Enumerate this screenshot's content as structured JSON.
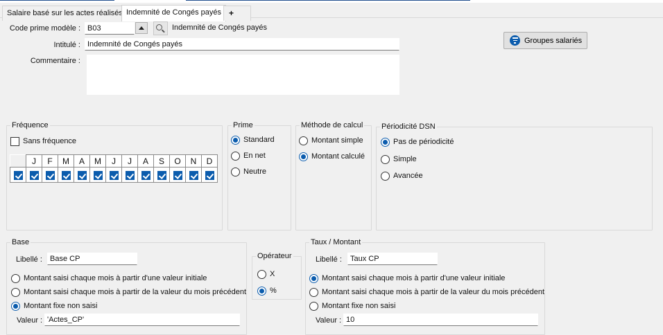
{
  "tabs": [
    {
      "label": "Salaire basé sur les actes réalisés"
    },
    {
      "label": "Indemnité de Congés payés"
    },
    {
      "label": "+"
    }
  ],
  "header": {
    "code_label": "Code prime modèle :",
    "code_value": "B03",
    "code_description": "Indemnité de Congés payés",
    "intitule_label": "Intitulé :",
    "intitule_value": "Indemnité de Congés payés",
    "commentaire_label": "Commentaire :",
    "commentaire_value": "",
    "groupes_button": "Groupes salariés"
  },
  "frequence": {
    "legend": "Fréquence",
    "sans_frequence_label": "Sans fréquence",
    "sans_frequence_checked": false,
    "months": [
      "J",
      "F",
      "M",
      "A",
      "M",
      "J",
      "J",
      "A",
      "S",
      "O",
      "N",
      "D"
    ],
    "months_checked": [
      true,
      true,
      true,
      true,
      true,
      true,
      true,
      true,
      true,
      true,
      true,
      true
    ]
  },
  "prime": {
    "legend": "Prime",
    "options": [
      "Standard",
      "En net",
      "Neutre"
    ],
    "selected": "Standard"
  },
  "methode": {
    "legend": "Méthode de calcul",
    "options": [
      "Montant simple",
      "Montant calculé"
    ],
    "selected": "Montant calculé"
  },
  "periodicite": {
    "legend": "Périodicité DSN",
    "options": [
      "Pas de périodicité",
      "Simple",
      "Avancée"
    ],
    "selected": "Pas de périodicité"
  },
  "base": {
    "legend": "Base",
    "libelle_label": "Libellé :",
    "libelle_value": "Base CP",
    "options": [
      "Montant saisi chaque mois à partir d'une valeur initiale",
      "Montant saisi chaque mois à partir de la valeur du mois précédent",
      "Montant fixe non saisi"
    ],
    "selected": "Montant fixe non saisi",
    "valeur_label": "Valeur :",
    "valeur_value": "'Actes_CP'"
  },
  "operateur": {
    "legend": "Opérateur",
    "options": [
      "X",
      "%"
    ],
    "selected": "%"
  },
  "taux": {
    "legend": "Taux / Montant",
    "libelle_label": "Libellé :",
    "libelle_value": "Taux CP",
    "options": [
      "Montant saisi chaque mois à partir d'une valeur initiale",
      "Montant saisi chaque mois à partir de la valeur du mois précédent",
      "Montant fixe non saisi"
    ],
    "selected": "Montant saisi chaque mois à partir d'une valeur initiale",
    "valeur_label": "Valeur :",
    "valeur_value": "10"
  },
  "colors": {
    "accent": "#0b5cad",
    "window": "#f0f0f0",
    "field": "#ffffff"
  },
  "icons": {
    "code_up": "triangle-up-icon",
    "code_search": "search-icon",
    "groupes": "filter-lines-icon"
  }
}
